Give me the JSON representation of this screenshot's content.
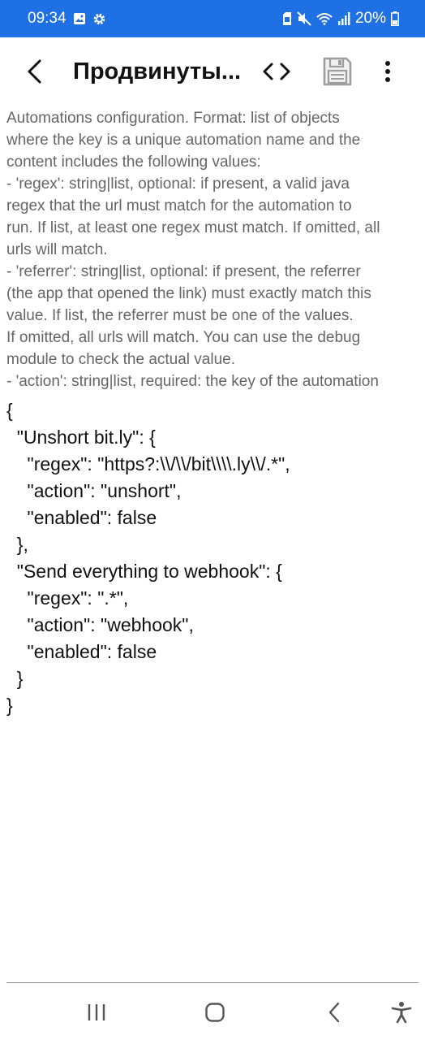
{
  "status_bar": {
    "time": "09:34",
    "battery": "20%",
    "icons_left": [
      "gallery-icon",
      "settings-gear-icon"
    ],
    "icons_right": [
      "sim-icon",
      "mute-icon",
      "wifi-icon",
      "signal-icon",
      "battery-icon"
    ]
  },
  "app_bar": {
    "title": "Продвинуты...",
    "icons": [
      "back-arrow-icon",
      "code-brackets-icon",
      "save-floppy-icon",
      "more-vert-icon"
    ]
  },
  "description": "Automations configuration. Format: list of objects\nwhere the key is a unique automation name and the\ncontent includes the following values:\n- 'regex': string|list, optional: if present, a valid java\nregex that the url must match for the automation to\nrun. If list, at least one regex must match. If omitted, all\nurls will match.\n- 'referrer': string|list, optional: if present, the referrer\n(the app that opened the link) must exactly match this\nvalue. If list, the referrer must be one of the values.\nIf omitted, all urls will match. You can use the debug\nmodule to check the actual value.\n- 'action': string|list, required: the key of the automation",
  "editor": {
    "content": "{\n  \"Unshort bit.ly\": {\n    \"regex\": \"https?:\\\\/\\\\/bit\\\\\\\\.ly\\\\/.*\",\n    \"action\": \"unshort\",\n    \"enabled\": false\n  },\n  \"Send everything to webhook\": {\n    \"regex\": \".*\",\n    \"action\": \"webhook\",\n    \"enabled\": false\n  }\n}"
  },
  "nav_bar": {
    "icons": [
      "recents-icon",
      "home-icon",
      "back-icon",
      "accessibility-icon"
    ]
  },
  "colors": {
    "status_bar_bg": "#1f6fe5",
    "description_text": "#666666",
    "editor_text": "#111111"
  }
}
